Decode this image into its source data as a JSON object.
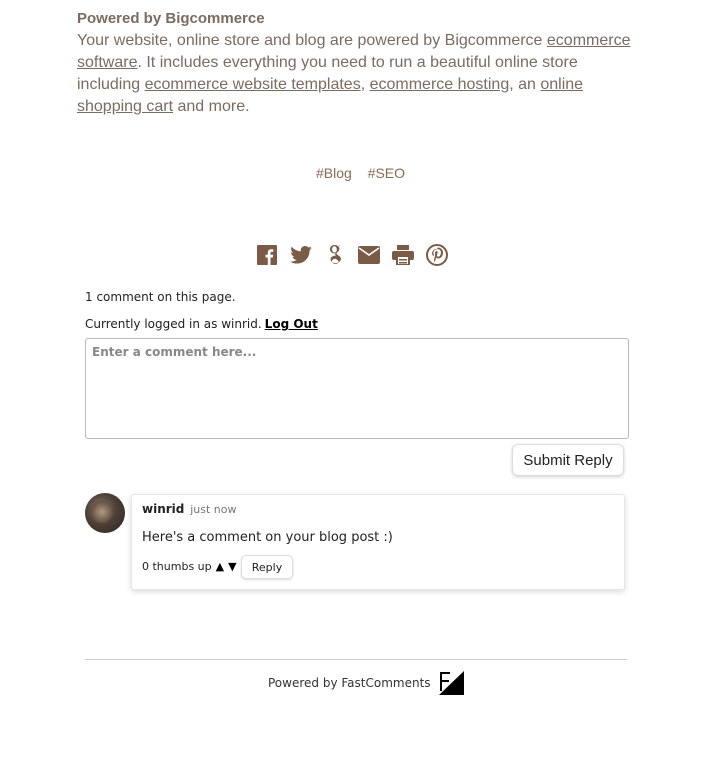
{
  "powered_by": {
    "title": "Powered by Bigcommerce",
    "text_before": "Your website, online store and blog are powered by Bigcommerce ",
    "link1": "ecommerce software",
    "text_mid1": ". It includes everything you need to run a beautiful online store including ",
    "link2": "ecommerce website templates",
    "sep1": ", ",
    "link3": "ecommerce hosting",
    "sep2": ", an ",
    "link4": "online shopping cart",
    "text_end": " and more."
  },
  "tags": [
    "#Blog",
    "#SEO"
  ],
  "share_icons": [
    "facebook-icon",
    "twitter-icon",
    "google-icon",
    "email-icon",
    "print-icon",
    "pinterest-icon"
  ],
  "colors": {
    "brown": "#7b5b45",
    "text": "#7b6b60"
  },
  "comments": {
    "count_text": "1 comment on this page.",
    "logged_in_text": "Currently logged in as winrid.",
    "logout_label": "Log Out",
    "input_placeholder": "Enter a comment here...",
    "submit_label": "Submit Reply",
    "items": [
      {
        "author": "winrid",
        "time": "just now",
        "text": "Here's a comment on your blog post :)",
        "votes": "0 thumbs up",
        "up": "▲",
        "down": "▼",
        "reply_label": "Reply"
      }
    ]
  },
  "footer": {
    "text": "Powered by FastComments"
  }
}
